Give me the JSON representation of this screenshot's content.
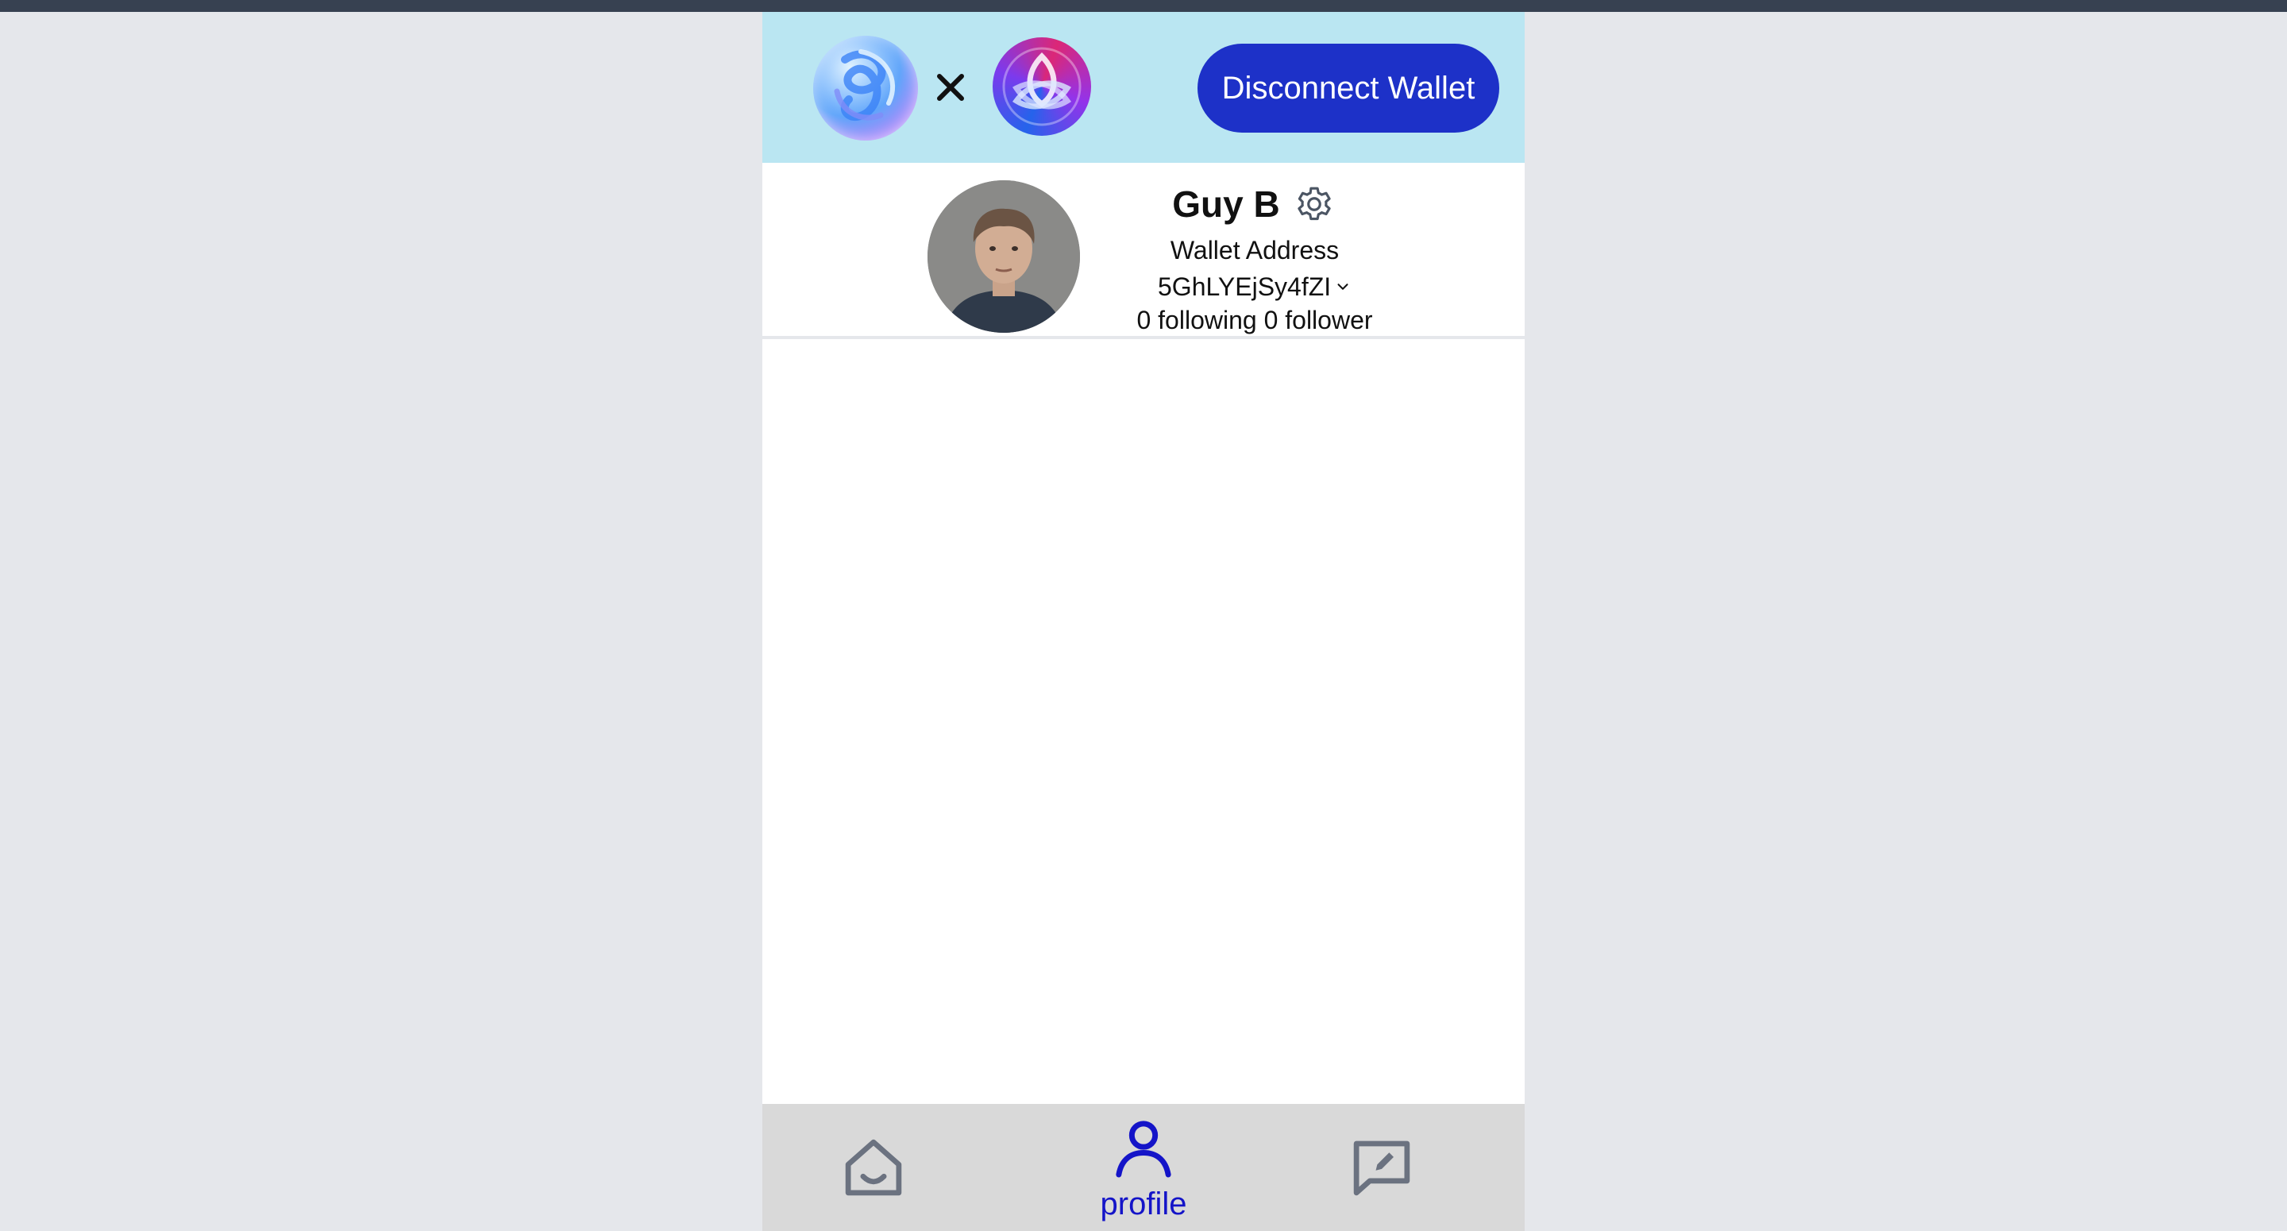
{
  "header": {
    "separator": "×",
    "disconnect_label": "Disconnect Wallet",
    "brand_color": "#bae6f2",
    "button_color": "#1d31c8"
  },
  "profile": {
    "name": "Guy B",
    "wallet_label": "Wallet Address",
    "wallet_address": "5GhLYEjSy4fZI",
    "following": "0 following",
    "followers": "0 follower"
  },
  "nav": {
    "items": [
      {
        "id": "home",
        "icon": "home-icon",
        "label": ""
      },
      {
        "id": "profile",
        "icon": "user-icon",
        "label": "profile",
        "active": true
      },
      {
        "id": "compose",
        "icon": "compose-message-icon",
        "label": ""
      }
    ],
    "active_color": "#1414c8",
    "inactive_color": "#6b7280"
  }
}
